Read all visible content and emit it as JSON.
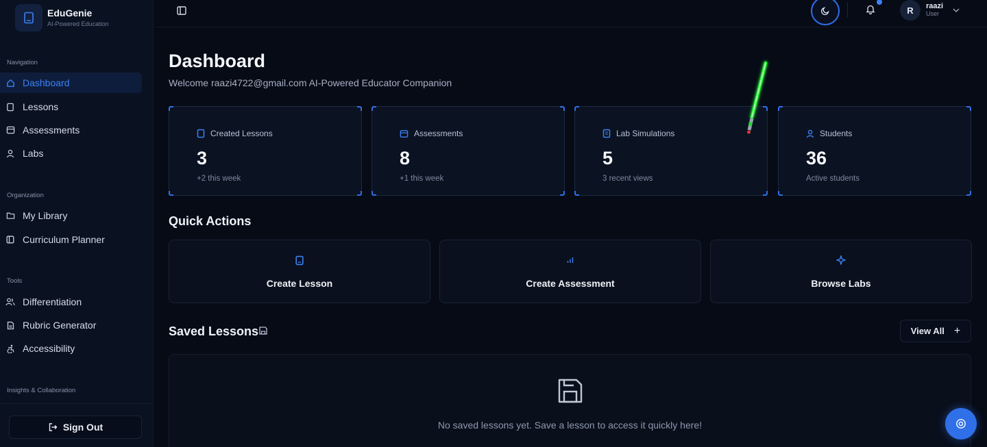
{
  "brand": {
    "name": "EduGenie",
    "tagline": "AI-Powered Education"
  },
  "sidebar": {
    "sections": [
      {
        "title": "Navigation"
      },
      {
        "title": "Organization"
      },
      {
        "title": "Tools"
      },
      {
        "title": "Insights & Collaboration"
      }
    ],
    "items": [
      {
        "label": "Dashboard",
        "icon": "home-icon",
        "active": true
      },
      {
        "label": "Lessons",
        "icon": "book-icon"
      },
      {
        "label": "Assessments",
        "icon": "calendar-icon"
      },
      {
        "label": "Labs",
        "icon": "user-icon"
      },
      {
        "label": "My Library",
        "icon": "folder-icon"
      },
      {
        "label": "Curriculum Planner",
        "icon": "panel-icon"
      },
      {
        "label": "Differentiation",
        "icon": "users-icon"
      },
      {
        "label": "Rubric Generator",
        "icon": "file-icon"
      },
      {
        "label": "Accessibility",
        "icon": "accessibility-icon"
      }
    ],
    "sign_out": "Sign Out"
  },
  "header": {
    "user": {
      "initial": "R",
      "name": "raazi",
      "role": "User"
    }
  },
  "main": {
    "title": "Dashboard",
    "welcome": "Welcome raazi4722@gmail.com AI-Powered Educator Companion",
    "stats": [
      {
        "label": "Created Lessons",
        "value": "3",
        "note": "+2 this week",
        "icon": "book-icon"
      },
      {
        "label": "Assessments",
        "value": "8",
        "note": "+1 this week",
        "icon": "calendar-icon"
      },
      {
        "label": "Lab Simulations",
        "value": "5",
        "note": "3 recent views",
        "icon": "flask-icon"
      },
      {
        "label": "Students",
        "value": "36",
        "note": "Active students",
        "icon": "user-icon"
      }
    ],
    "quick_actions_title": "Quick Actions",
    "quick_actions": [
      {
        "label": "Create Lesson",
        "icon": "book-icon"
      },
      {
        "label": "Create Assessment",
        "icon": "bar-chart-icon"
      },
      {
        "label": "Browse Labs",
        "icon": "sparkle-icon"
      }
    ],
    "saved_title": "Saved Lessons",
    "view_all": "View All",
    "empty_message": "No saved lessons yet. Save a lesson to access it quickly here!"
  },
  "colors": {
    "accent": "#3b82f6",
    "background": "#070b16",
    "sidebar": "#0a1120"
  }
}
